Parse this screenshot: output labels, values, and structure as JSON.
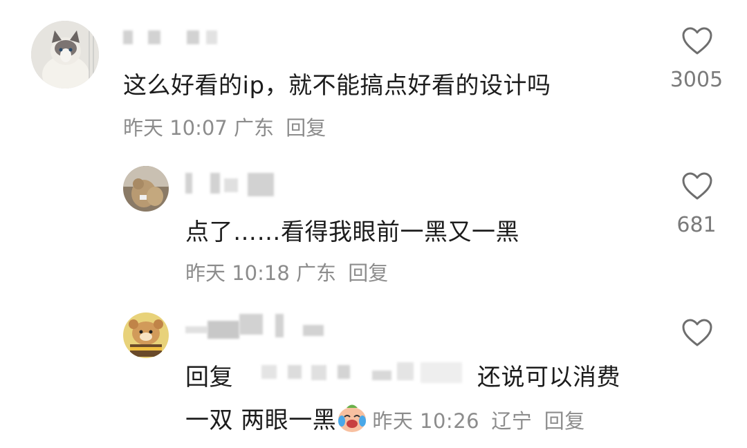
{
  "comments": [
    {
      "text": "这么好看的ip，就不能搞点好看的设计吗",
      "time": "昨天 10:07",
      "location": "广东",
      "reply_label": "回复",
      "likes": "3005",
      "avatar_icon": "cat-avatar"
    },
    {
      "text": "点了……看得我眼前一黑又一黑",
      "time": "昨天 10:18",
      "location": "广东",
      "reply_label": "回复",
      "likes": "681",
      "avatar_icon": "plush-bear-avatar"
    },
    {
      "reply_prefix": "回复",
      "text_line1": "还说可以消费",
      "text_line2": "一双 两眼一黑",
      "emoji": "crying-laughing-emoji",
      "time": "昨天 10:26",
      "location": "辽宁",
      "reply_label": "回复",
      "likes": "",
      "avatar_icon": "duffy-bear-avatar"
    }
  ],
  "colors": {
    "text": "#1c1c1c",
    "meta": "#8c8c8c",
    "icon": "#6e6e6e"
  }
}
